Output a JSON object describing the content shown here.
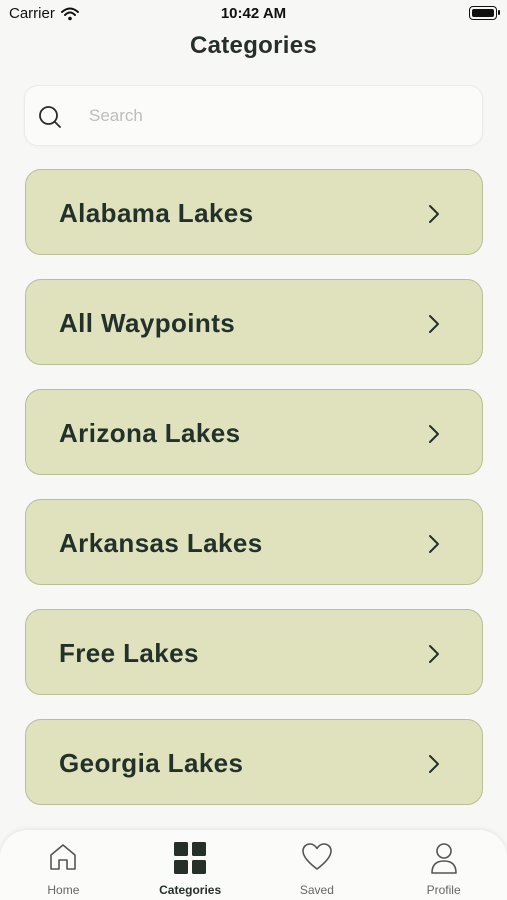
{
  "status_bar": {
    "carrier": "Carrier",
    "time": "10:42 AM",
    "battery_level": 1.0
  },
  "header": {
    "title": "Categories"
  },
  "search": {
    "placeholder": "Search",
    "value": "",
    "icon": "search-icon"
  },
  "categories": [
    {
      "label": "Alabama Lakes"
    },
    {
      "label": "All Waypoints"
    },
    {
      "label": "Arizona Lakes"
    },
    {
      "label": "Arkansas Lakes"
    },
    {
      "label": "Free Lakes"
    },
    {
      "label": "Georgia Lakes"
    }
  ],
  "tab_bar": {
    "tabs": [
      {
        "label": "Home",
        "icon": "home-icon",
        "active": false
      },
      {
        "label": "Categories",
        "icon": "grid-icon",
        "active": true
      },
      {
        "label": "Saved",
        "icon": "heart-icon",
        "active": false
      },
      {
        "label": "Profile",
        "icon": "person-icon",
        "active": false
      }
    ]
  },
  "colors": {
    "accent": "#263028",
    "card_background": "#dfe2bd",
    "card_border": "#b9bd9c",
    "page_background": "#f7f7f5"
  }
}
